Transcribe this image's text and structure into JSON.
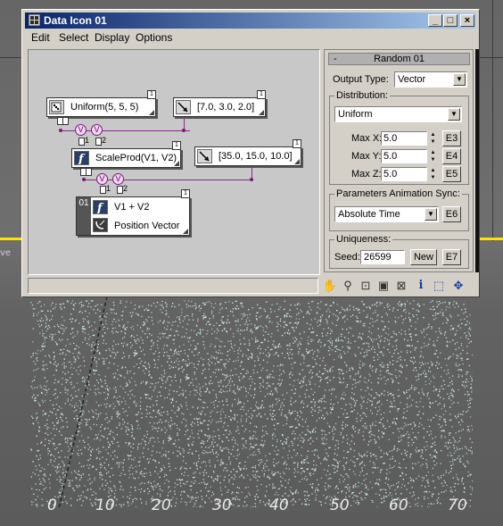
{
  "window": {
    "title": "Data Icon 01",
    "controls": {
      "minimize": "_",
      "maximize": "□",
      "close": "×"
    }
  },
  "menu": [
    "Edit",
    "Select",
    "Display",
    "Options"
  ],
  "nodes": [
    {
      "label": "Uniform(5, 5, 5)",
      "icon": "dice-icon",
      "port_number": "1"
    },
    {
      "label": "[7.0, 3.0, 2.0]",
      "icon": "vector-arrow-icon",
      "port_number": "1"
    },
    {
      "label": "ScaleProd(V1, V2)",
      "icon": "function-icon",
      "port_number": "1"
    },
    {
      "label": "[35.0, 15.0, 10.0]",
      "icon": "vector-arrow-icon",
      "port_number": "1"
    },
    {
      "index": "01",
      "label": "V1 + V2",
      "output_label": "Position Vector",
      "icon": "function-icon",
      "output_icon": "satellite-dish-icon",
      "port_number": "1"
    }
  ],
  "connectors": {
    "v_symbol": "V",
    "port1": "1",
    "port2": "2"
  },
  "rollout": {
    "title": "Random 01",
    "collapse": "-",
    "output_type_label": "Output Type:",
    "output_type_value": "Vector",
    "distribution_group": "Distribution:",
    "distribution_value": "Uniform",
    "max": [
      {
        "label": "Max X:",
        "value": "5.0",
        "button": "E3"
      },
      {
        "label": "Max Y:",
        "value": "5.0",
        "button": "E4"
      },
      {
        "label": "Max Z:",
        "value": "5.0",
        "button": "E5"
      }
    ],
    "sync_group": "Parameters Animation Sync:",
    "sync_value": "Absolute Time",
    "sync_button": "E6",
    "uniqueness_group": "Uniqueness:",
    "seed_label": "Seed:",
    "seed_value": "26599",
    "new_button": "New",
    "seed_button": "E7"
  },
  "toolbar_icons": [
    "pan-hand-icon",
    "zoom-icon",
    "zoom-region-icon",
    "zoom-extents-icon",
    "delete-icon",
    "info-icon",
    "select-region-icon",
    "navigate-icon"
  ],
  "viewport": {
    "label": "ve",
    "axis_labels": [
      "0",
      "10",
      "20",
      "30",
      "40",
      "50",
      "60",
      "70"
    ],
    "particle_color": "#ddfff7",
    "highlight_color": "#ffe400"
  }
}
